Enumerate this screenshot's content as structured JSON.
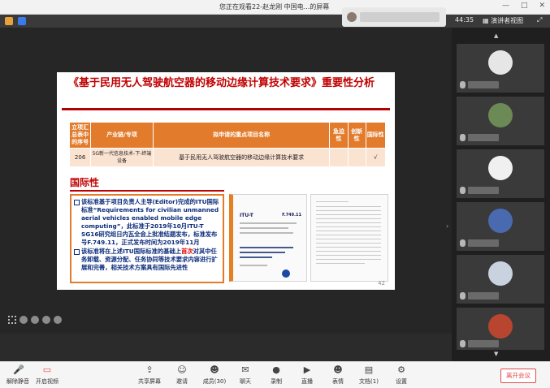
{
  "window": {
    "title": "您正在观看22-赵龙刚 中国电...的屏幕",
    "controls": [
      "—",
      "□",
      "✕"
    ]
  },
  "meeting": {
    "id_label": "",
    "timer": "44:35",
    "layout_label": "演讲者视图",
    "fullscreen_label": "⤢"
  },
  "slide": {
    "title": "《基于民用无人驾驶航空器的移动边缘计算技术要求》重要性分析",
    "table": {
      "headers": [
        "立项汇总表中的序号",
        "产业链/专项",
        "拟申请的重点项目名称",
        "急迫性",
        "创新性",
        "国际性"
      ],
      "rows": [
        [
          "206",
          "5G新一代信息技术-下-终端设备",
          "基于民用无人驾驶航空器的移动边缘计算技术要求",
          "",
          "",
          "√"
        ]
      ]
    },
    "section_title": "国际性",
    "bullets": [
      {
        "text": "该标准基于项目负责人主导(Editor)完成的ITU国际标准“Requirements for civilian unmanned aerial vehicles enabled mobile edge computing”，此标准于2019年10月ITU-T SG16研究组日内瓦全会上批准结题发布，标准发布号F.749.11，正式发布时间为2019年11月"
      },
      {
        "pre": "该标准将在上述ITU国际标准的基础上",
        "red": "首次",
        "post": "对其中任务卸载、资源分配、任务协同等技术要求内容进行扩展和完善，相关技术方案具有国际先进性"
      }
    ],
    "doc": {
      "org": "ITU-T",
      "number": "F.749.11"
    },
    "page_number": "42"
  },
  "controls": [
    {
      "icon": "🎤",
      "label": "解除静音"
    },
    {
      "icon": "▭",
      "label": "开启视频"
    },
    {
      "icon": "⇪",
      "label": "共享屏幕"
    },
    {
      "icon": "☺",
      "label": "邀请"
    },
    {
      "icon": "☻",
      "label": "成员(30)"
    },
    {
      "icon": "✉",
      "label": "聊天"
    },
    {
      "icon": "●",
      "label": "录制"
    },
    {
      "icon": "▶",
      "label": "直播"
    },
    {
      "icon": "☻",
      "label": "表情"
    },
    {
      "icon": "▤",
      "label": "文档(1)"
    },
    {
      "icon": "⚙",
      "label": "设置"
    }
  ],
  "leave_label": "离开会议",
  "colors": {
    "title_red": "#c00000",
    "table_orange": "#e27b2b",
    "body_blue": "#0a2a7a",
    "leave_red": "#e34b4b"
  }
}
